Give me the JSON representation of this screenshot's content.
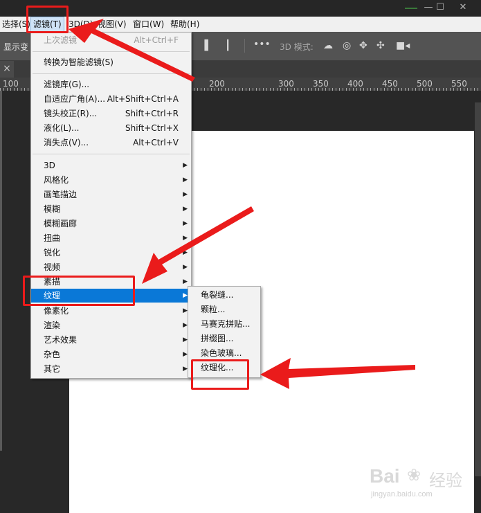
{
  "window": {
    "minimize": "—",
    "maximize": "☐",
    "close": "✕"
  },
  "menubar": {
    "items": [
      {
        "label": "选择(S)"
      },
      {
        "label": "滤镜(T)"
      },
      {
        "label": "3D(D)"
      },
      {
        "label": "视图(V)"
      },
      {
        "label": "窗口(W)"
      },
      {
        "label": "帮助(H)"
      }
    ]
  },
  "options": {
    "show_label": "显示变",
    "mode_label": "3D 模式:",
    "more": "•••"
  },
  "tab": {
    "close": "×"
  },
  "ruler": {
    "labels": [
      "100",
      "200",
      "300",
      "350",
      "400",
      "450",
      "500",
      "550"
    ]
  },
  "filter_menu": {
    "last_filter": {
      "label": "上次滤镜",
      "shortcut": "Alt+Ctrl+F"
    },
    "smart": {
      "label": "转换为智能滤镜(S)"
    },
    "group1": [
      {
        "label": "滤镜库(G)...",
        "shortcut": ""
      },
      {
        "label": "自适应广角(A)...",
        "shortcut": "Alt+Shift+Ctrl+A"
      },
      {
        "label": "镜头校正(R)...",
        "shortcut": "Shift+Ctrl+R"
      },
      {
        "label": "液化(L)...",
        "shortcut": "Shift+Ctrl+X"
      },
      {
        "label": "消失点(V)...",
        "shortcut": "Alt+Ctrl+V"
      }
    ],
    "group2": [
      {
        "label": "3D"
      },
      {
        "label": "风格化"
      },
      {
        "label": "画笔描边"
      },
      {
        "label": "模糊"
      },
      {
        "label": "模糊画廊"
      },
      {
        "label": "扭曲"
      },
      {
        "label": "锐化"
      },
      {
        "label": "视频"
      },
      {
        "label": "素描"
      },
      {
        "label": "纹理"
      },
      {
        "label": "像素化"
      },
      {
        "label": "渲染"
      },
      {
        "label": "艺术效果"
      },
      {
        "label": "杂色"
      },
      {
        "label": "其它"
      }
    ]
  },
  "texture_submenu": {
    "items": [
      {
        "label": "龟裂缝..."
      },
      {
        "label": "颗粒..."
      },
      {
        "label": "马赛克拼贴..."
      },
      {
        "label": "拼缀图..."
      },
      {
        "label": "染色玻璃..."
      },
      {
        "label": "纹理化..."
      }
    ]
  },
  "watermark": {
    "brand": "Bai",
    "brand2": "经验",
    "url": "jingyan.baidu.com"
  },
  "colors": {
    "highlight": "#0a78d7",
    "annotation": "#ea1b1b"
  }
}
